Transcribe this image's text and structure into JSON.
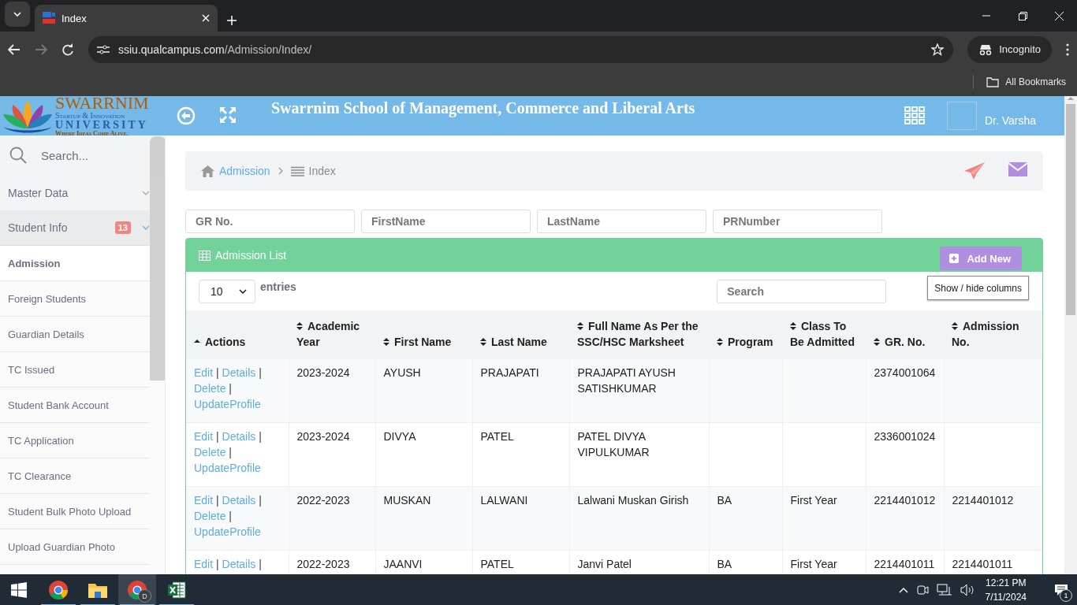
{
  "browser": {
    "tab_title": "Index",
    "url_host": "ssiu.qualcampus.com",
    "url_path": "/Admission/Index/",
    "profile": "Incognito",
    "bookmarks": "All Bookmarks"
  },
  "header": {
    "logo": {
      "name": "SWARRNIM",
      "line2": "Startup & Innovation",
      "line3": "UNIVERSITY",
      "tagline": "Where Ideas Come Alive."
    },
    "title": "Swarrnim School of Management, Commerce and Liberal Arts",
    "user": "Dr. Varsha"
  },
  "sidebar": {
    "search_placeholder": "Search...",
    "items": [
      {
        "kind": "group",
        "label": "Master Data",
        "active": false
      },
      {
        "kind": "group",
        "label": "Student Info",
        "active": true,
        "badge": "13",
        "color": "#f28482"
      },
      {
        "kind": "link",
        "label": "Admission",
        "selected": true
      },
      {
        "kind": "link",
        "label": "Foreign Students",
        "selected": false
      },
      {
        "kind": "link",
        "label": "Guardian Details",
        "selected": false
      },
      {
        "kind": "link",
        "label": "TC Issued",
        "selected": false
      },
      {
        "kind": "link",
        "label": "Student Bank Account",
        "selected": false
      },
      {
        "kind": "link",
        "label": "TC Application",
        "selected": false
      },
      {
        "kind": "link",
        "label": "TC Clearance",
        "selected": false
      },
      {
        "kind": "link",
        "label": "Student Bulk Photo Upload",
        "selected": false
      },
      {
        "kind": "link",
        "label": "Upload Guardian Photo",
        "selected": false
      }
    ]
  },
  "breadcrumb": [
    "Admission",
    "Index"
  ],
  "filters": [
    {
      "placeholder": "GR No."
    },
    {
      "placeholder": "FirstName"
    },
    {
      "placeholder": "LastName"
    },
    {
      "placeholder": "PRNumber"
    }
  ],
  "card": {
    "title": "Admission List",
    "add_button": "Add New",
    "page_size": "10",
    "entries_label": "entries",
    "search_placeholder": "Search",
    "columns_button": "Show / hide columns"
  },
  "table": {
    "columns": [
      {
        "label": "Actions",
        "sorted": true
      },
      {
        "label": "Academic Year",
        "sorted": false
      },
      {
        "label": "First Name",
        "sorted": false
      },
      {
        "label": "Last Name",
        "sorted": false
      },
      {
        "label": "Full Name As Per the SSC/HSC Marksheet",
        "sorted": false
      },
      {
        "label": "Program",
        "sorted": false
      },
      {
        "label": "Class To Be Admitted",
        "sorted": false
      },
      {
        "label": "GR. No.",
        "sorted": false
      },
      {
        "label": "Admission No.",
        "sorted": false
      }
    ],
    "rows": [
      {
        "cells": [
          [
            "Edit",
            "|",
            "Details",
            "|",
            "Delete",
            "|",
            "UpdateProfile"
          ],
          "2023-2024",
          "AYUSH",
          "PRAJAPATI",
          "PRAJAPATI AYUSH SATISHKUMAR",
          "",
          "",
          "2374001064",
          ""
        ]
      },
      {
        "cells": [
          [
            "Edit",
            "|",
            "Details",
            "|",
            "Delete",
            "|",
            "UpdateProfile"
          ],
          "2023-2024",
          "DIVYA",
          "PATEL",
          "PATEL DIVYA VIPULKUMAR",
          "",
          "",
          "2336001024",
          ""
        ]
      },
      {
        "cells": [
          [
            "Edit",
            "|",
            "Details",
            "|",
            "Delete",
            "|",
            "UpdateProfile"
          ],
          "2022-2023",
          "MUSKAN",
          "LALWANI",
          "Lalwani Muskan Girish",
          "BA",
          "First Year",
          "2214401012",
          "2214401012"
        ]
      },
      {
        "cells": [
          [
            "Edit",
            "|",
            "Details",
            "|"
          ],
          "2022-2023",
          "JAANVI",
          "PATEL",
          "Janvi Patel",
          "BA",
          "First Year",
          "2214401011",
          "2214401011"
        ]
      }
    ]
  },
  "taskbar": {
    "apps": [
      {
        "kind": "browser",
        "selected": false
      },
      {
        "kind": "folder",
        "selected": false
      },
      {
        "kind": "browser",
        "selected": true,
        "badge": "D"
      },
      {
        "kind": "spreadsheet",
        "selected": false
      }
    ],
    "time": "12:21 PM",
    "date": "7/11/2024",
    "notifications": "1"
  }
}
